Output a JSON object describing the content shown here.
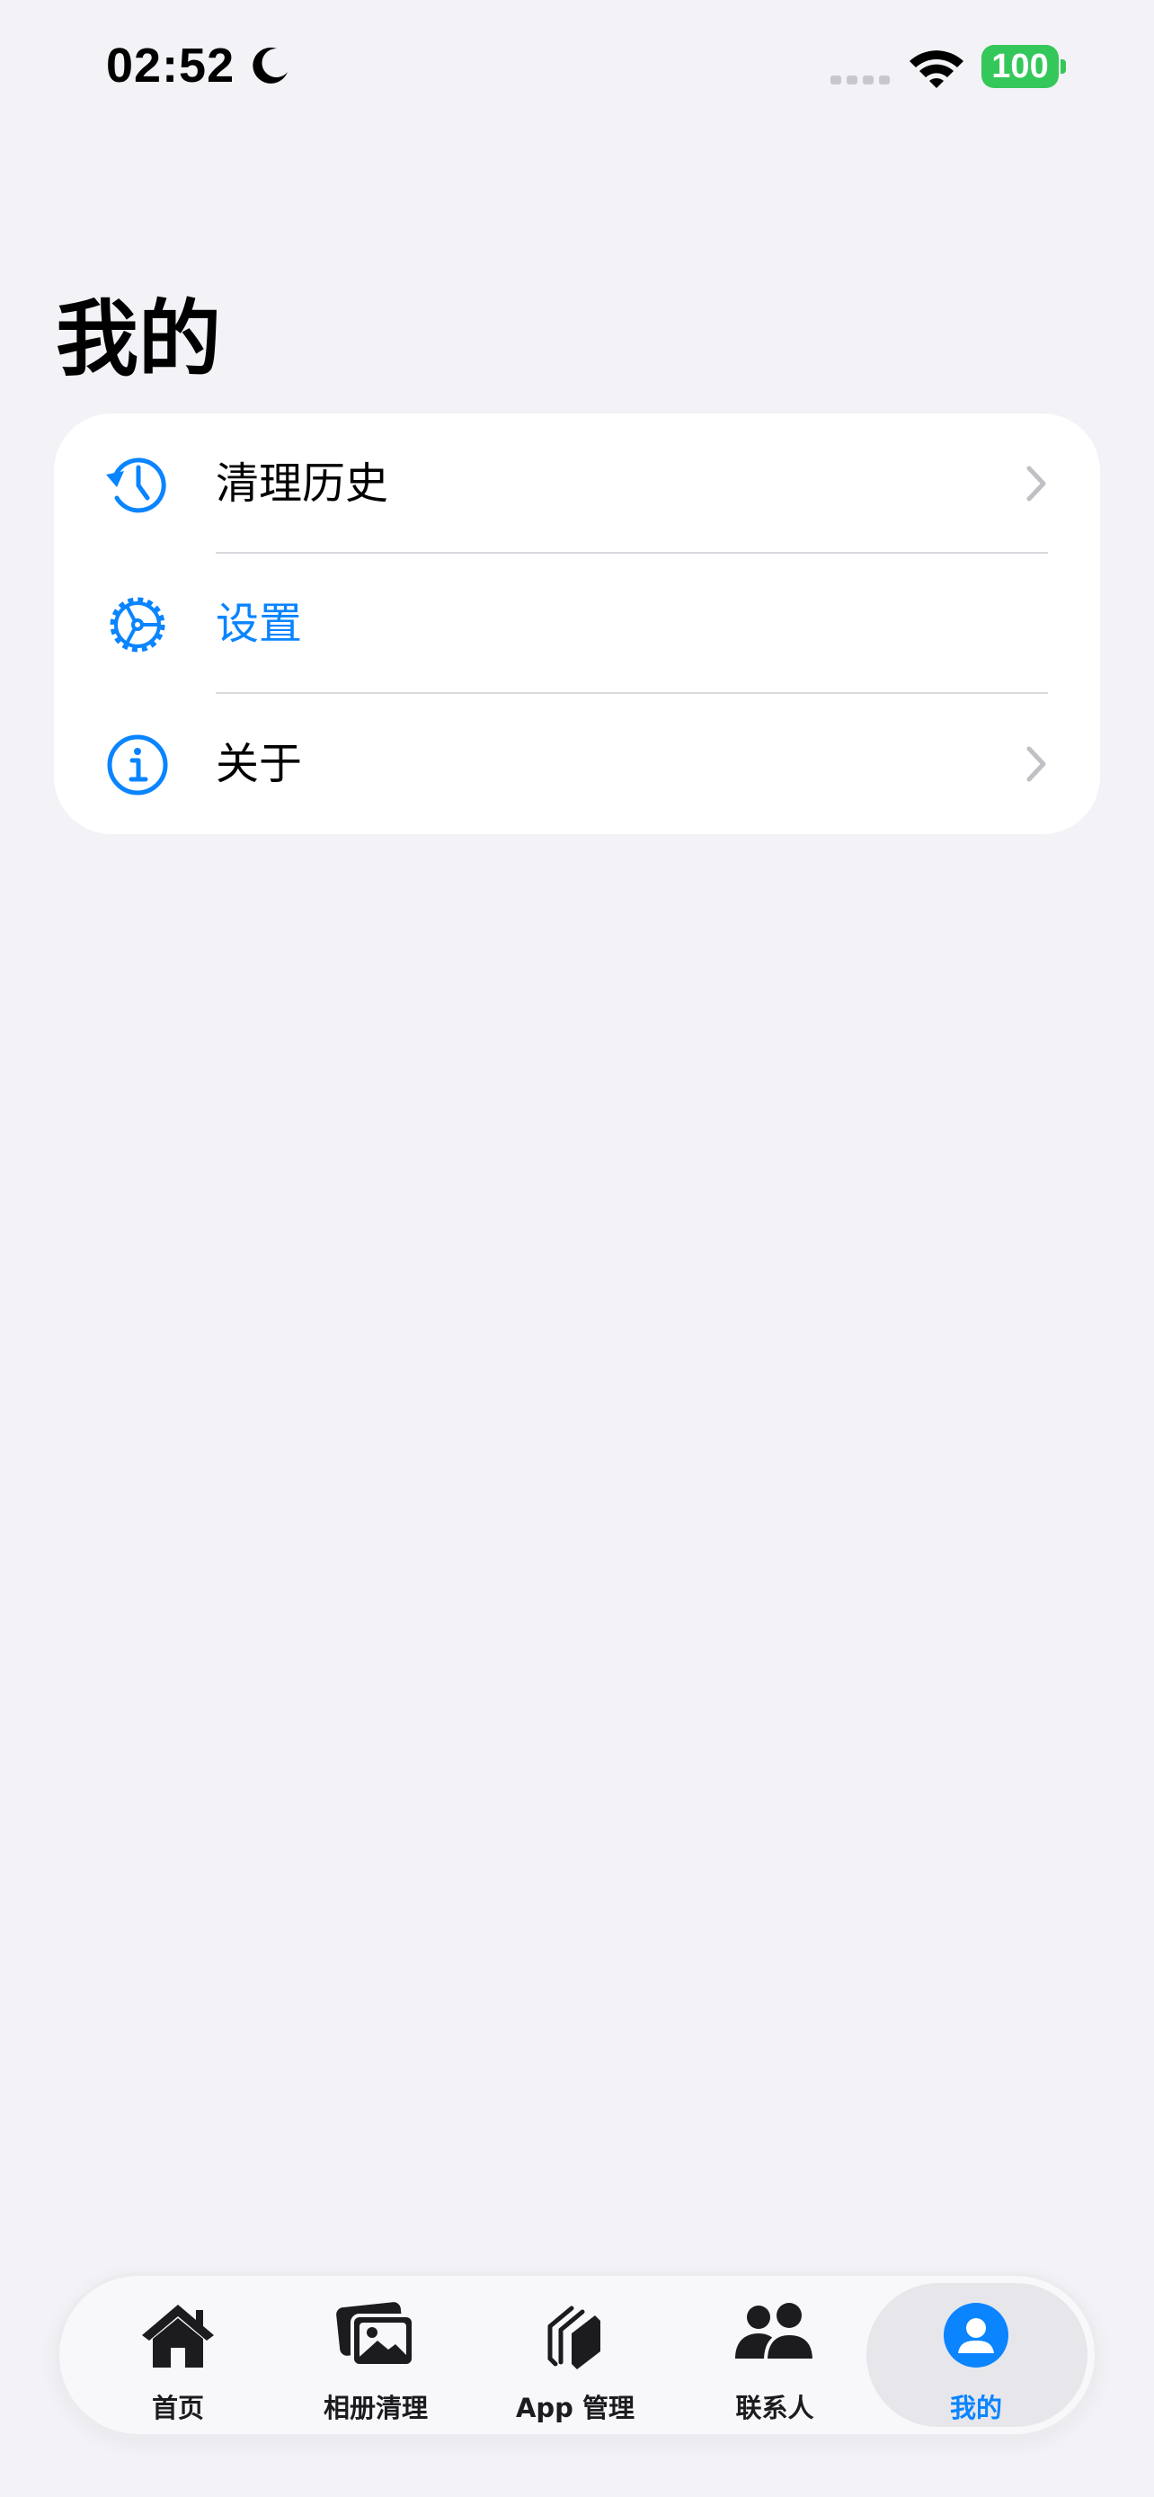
{
  "status_bar": {
    "time": "02:52",
    "battery": "100"
  },
  "page": {
    "title": "我的"
  },
  "menu": {
    "items": [
      {
        "label": "清理历史",
        "icon": "history-icon",
        "has_chevron": true
      },
      {
        "label": "设置",
        "icon": "gear-icon",
        "has_chevron": false
      },
      {
        "label": "关于",
        "icon": "info-icon",
        "has_chevron": true
      }
    ]
  },
  "tabbar": {
    "tabs": [
      {
        "label": "首页",
        "icon": "home-icon"
      },
      {
        "label": "相册清理",
        "icon": "photos-icon"
      },
      {
        "label": "App 管理",
        "icon": "apps-icon"
      },
      {
        "label": "联系人",
        "icon": "contacts-icon"
      },
      {
        "label": "我的",
        "icon": "profile-icon",
        "active": true
      }
    ]
  },
  "colors": {
    "accent": "#0A84FF",
    "background": "#F2F2F7",
    "battery": "#34C759"
  }
}
